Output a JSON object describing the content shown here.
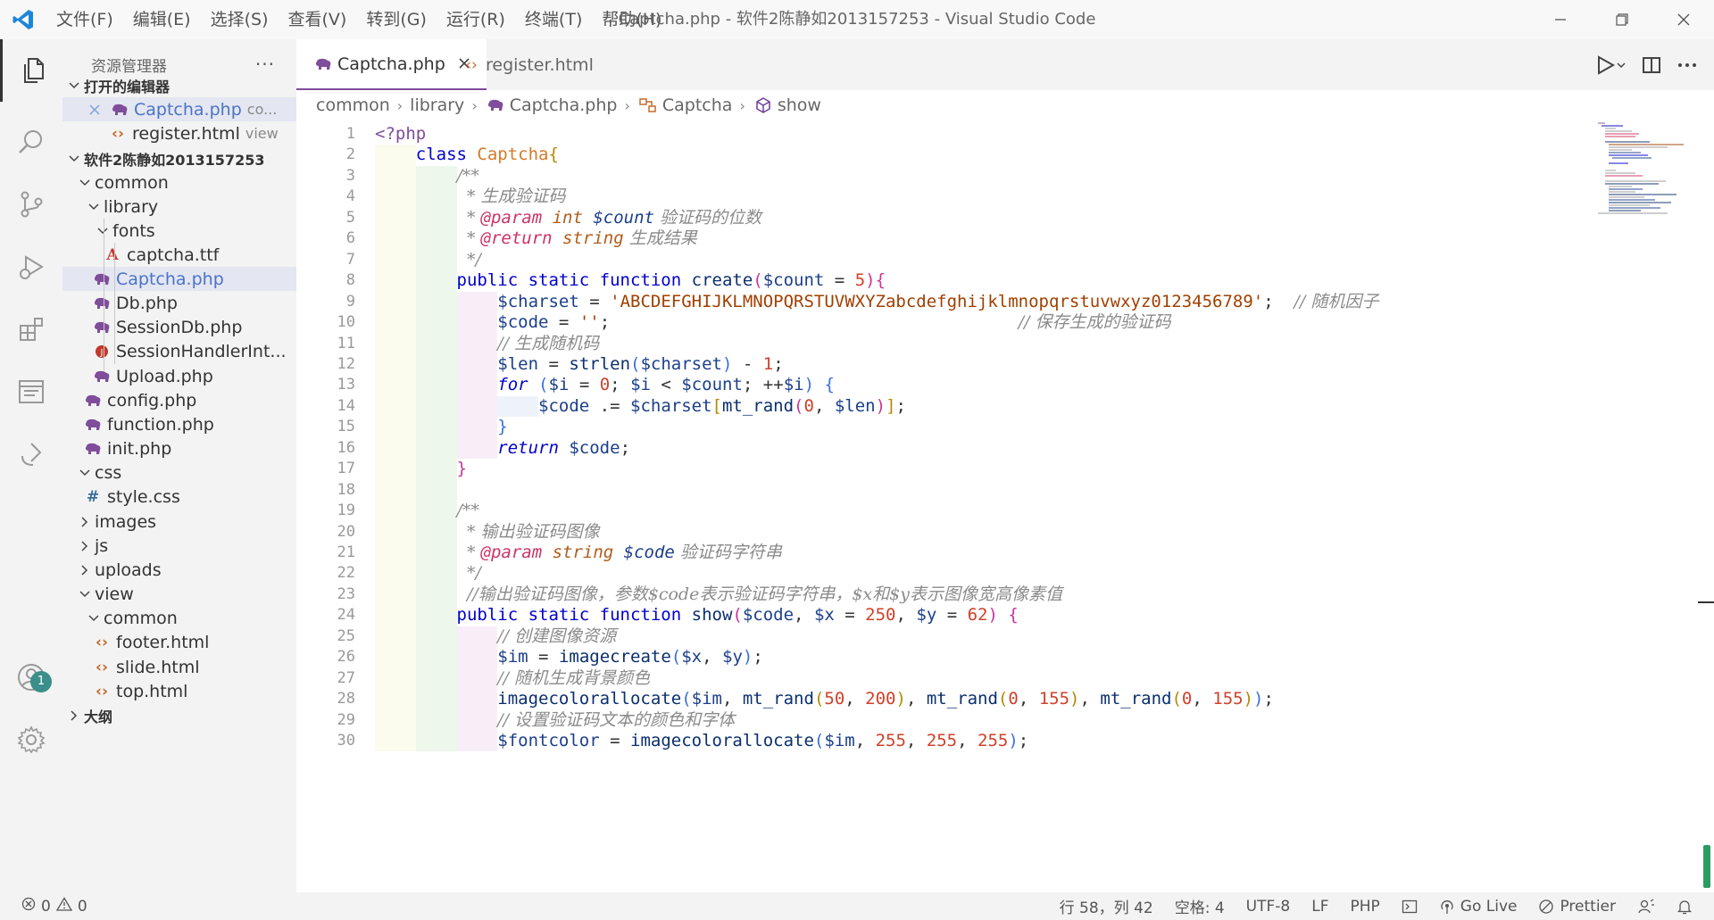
{
  "window": {
    "title": "Captcha.php - 软件2陈静如2013157253 - Visual Studio Code",
    "menu": [
      "文件(F)",
      "编辑(E)",
      "选择(S)",
      "查看(V)",
      "转到(G)",
      "运行(R)",
      "终端(T)",
      "帮助(H)"
    ]
  },
  "sidebar": {
    "title": "资源管理器",
    "more": "···",
    "open_editors_label": "打开的编辑器",
    "open_editors": [
      {
        "name": "Captcha.php",
        "desc": "co..."
      },
      {
        "name": "register.html",
        "desc": "view"
      }
    ],
    "project_label": "软件2陈静如2013157253",
    "outline_label": "大纲",
    "tree": [
      {
        "name": "common"
      },
      {
        "name": "library"
      },
      {
        "name": "fonts"
      },
      {
        "name": "captcha.ttf"
      },
      {
        "name": "Captcha.php"
      },
      {
        "name": "Db.php"
      },
      {
        "name": "SessionDb.php"
      },
      {
        "name": "SessionHandlerInt..."
      },
      {
        "name": "Upload.php"
      },
      {
        "name": "config.php"
      },
      {
        "name": "function.php"
      },
      {
        "name": "init.php"
      },
      {
        "name": "css"
      },
      {
        "name": "style.css"
      },
      {
        "name": "images"
      },
      {
        "name": "js"
      },
      {
        "name": "uploads"
      },
      {
        "name": "view"
      },
      {
        "name": "common"
      },
      {
        "name": "footer.html"
      },
      {
        "name": "slide.html"
      },
      {
        "name": "top.html"
      }
    ]
  },
  "activity": {
    "accounts_badge": "1"
  },
  "tabs": [
    {
      "label": "Captcha.php",
      "active": true
    },
    {
      "label": "register.html",
      "active": false
    }
  ],
  "breadcrumb": [
    "common",
    "library",
    "Captcha.php",
    "Captcha",
    "show"
  ],
  "line_numbers": [
    "1",
    "2",
    "3",
    "4",
    "5",
    "6",
    "7",
    "8",
    "9",
    "10",
    "11",
    "12",
    "13",
    "14",
    "15",
    "16",
    "17",
    "18",
    "19",
    "20",
    "21",
    "22",
    "23",
    "24",
    "25",
    "26",
    "27",
    "28",
    "29",
    "30"
  ],
  "code": [
    [
      [
        "<?php",
        "tag"
      ]
    ],
    [
      [
        "    ",
        ""
      ],
      [
        "class ",
        "kw"
      ],
      [
        "Captcha",
        "cls"
      ],
      [
        "{",
        "br"
      ]
    ],
    [
      [
        "        ",
        ""
      ],
      [
        "/**",
        "cmt"
      ]
    ],
    [
      [
        "         ",
        ""
      ],
      [
        "* 生成验证码",
        "cmt"
      ]
    ],
    [
      [
        "         ",
        ""
      ],
      [
        "* ",
        "cmt"
      ],
      [
        "@param",
        "doc"
      ],
      [
        " int ",
        "type"
      ],
      [
        "$count",
        "var-i"
      ],
      [
        " 验证码的位数",
        "cmt"
      ]
    ],
    [
      [
        "         ",
        ""
      ],
      [
        "* ",
        "cmt"
      ],
      [
        "@return",
        "doc"
      ],
      [
        " string",
        "type"
      ],
      [
        " 生成结果",
        "cmt"
      ]
    ],
    [
      [
        "         ",
        ""
      ],
      [
        "*/",
        "cmt"
      ]
    ],
    [
      [
        "        ",
        ""
      ],
      [
        "public static function ",
        "kw"
      ],
      [
        "create",
        "fn"
      ],
      [
        "(",
        "br2"
      ],
      [
        "$count",
        "var"
      ],
      [
        " = ",
        "pun"
      ],
      [
        "5",
        "num"
      ],
      [
        ")",
        "br2"
      ],
      [
        "{",
        "br2"
      ]
    ],
    [
      [
        "            ",
        ""
      ],
      [
        "$charset",
        "var"
      ],
      [
        " = ",
        "pun"
      ],
      [
        "'ABCDEFGHIJKLMNOPQRSTUVWXYZabcdefghijklmnopqrstuvwxyz0123456789'",
        "str"
      ],
      [
        ";  ",
        "pun"
      ],
      [
        "// 随机因子",
        "cmt"
      ]
    ],
    [
      [
        "            ",
        ""
      ],
      [
        "$code",
        "var"
      ],
      [
        " = ",
        "pun"
      ],
      [
        "''",
        "str"
      ],
      [
        ";",
        "pun"
      ],
      [
        "                                        ",
        ""
      ],
      [
        "// 保存生成的验证码",
        "cmt"
      ]
    ],
    [
      [
        "            ",
        ""
      ],
      [
        "// 生成随机码",
        "cmt"
      ]
    ],
    [
      [
        "            ",
        ""
      ],
      [
        "$len",
        "var"
      ],
      [
        " = ",
        "pun"
      ],
      [
        "strlen",
        "fn"
      ],
      [
        "(",
        "br3"
      ],
      [
        "$charset",
        "var"
      ],
      [
        ")",
        "br3"
      ],
      [
        " - ",
        "pun"
      ],
      [
        "1",
        "num"
      ],
      [
        ";",
        "pun"
      ]
    ],
    [
      [
        "            ",
        ""
      ],
      [
        "for",
        "kw-i"
      ],
      [
        " (",
        "br3"
      ],
      [
        "$i",
        "var"
      ],
      [
        " = ",
        "pun"
      ],
      [
        "0",
        "num"
      ],
      [
        "; ",
        "pun"
      ],
      [
        "$i",
        "var"
      ],
      [
        " < ",
        "pun"
      ],
      [
        "$count",
        "var"
      ],
      [
        "; ++",
        "pun"
      ],
      [
        "$i",
        "var"
      ],
      [
        ") {",
        "br3"
      ]
    ],
    [
      [
        "                ",
        ""
      ],
      [
        "$code",
        "var"
      ],
      [
        " .= ",
        "pun"
      ],
      [
        "$charset",
        "var"
      ],
      [
        "[",
        "br"
      ],
      [
        "mt_rand",
        "fn"
      ],
      [
        "(",
        "br2"
      ],
      [
        "0",
        "num"
      ],
      [
        ", ",
        "pun"
      ],
      [
        "$len",
        "var"
      ],
      [
        ")",
        "br2"
      ],
      [
        "]",
        "br"
      ],
      [
        ";",
        "pun"
      ]
    ],
    [
      [
        "            ",
        ""
      ],
      [
        "}",
        "br3"
      ]
    ],
    [
      [
        "            ",
        ""
      ],
      [
        "return",
        "kw-i"
      ],
      [
        " $code",
        "var"
      ],
      [
        ";",
        "pun"
      ]
    ],
    [
      [
        "        ",
        ""
      ],
      [
        "}",
        "br2"
      ]
    ],
    [
      [
        "",
        ""
      ]
    ],
    [
      [
        "        ",
        ""
      ],
      [
        "/**",
        "cmt"
      ]
    ],
    [
      [
        "         ",
        ""
      ],
      [
        "* 输出验证码图像",
        "cmt"
      ]
    ],
    [
      [
        "         ",
        ""
      ],
      [
        "* ",
        "cmt"
      ],
      [
        "@param",
        "doc"
      ],
      [
        " string",
        "type"
      ],
      [
        " $code",
        "var-i"
      ],
      [
        " 验证码字符串",
        "cmt"
      ]
    ],
    [
      [
        "         ",
        ""
      ],
      [
        "*/",
        "cmt"
      ]
    ],
    [
      [
        "         ",
        ""
      ],
      [
        "//输出验证码图像，参数$code表示验证码字符串，$x和$y表示图像宽高像素值",
        "cmt"
      ]
    ],
    [
      [
        "        ",
        ""
      ],
      [
        "public static function ",
        "kw"
      ],
      [
        "show",
        "fn"
      ],
      [
        "(",
        "br2"
      ],
      [
        "$code",
        "var"
      ],
      [
        ", ",
        "pun"
      ],
      [
        "$x",
        "var"
      ],
      [
        " = ",
        "pun"
      ],
      [
        "250",
        "num"
      ],
      [
        ", ",
        "pun"
      ],
      [
        "$y",
        "var"
      ],
      [
        " = ",
        "pun"
      ],
      [
        "62",
        "num"
      ],
      [
        ") ",
        "br2"
      ],
      [
        "{",
        "br2"
      ]
    ],
    [
      [
        "            ",
        ""
      ],
      [
        "// 创建图像资源",
        "cmt"
      ]
    ],
    [
      [
        "            ",
        ""
      ],
      [
        "$im",
        "var"
      ],
      [
        " = ",
        "pun"
      ],
      [
        "imagecreate",
        "fn"
      ],
      [
        "(",
        "br3"
      ],
      [
        "$x",
        "var"
      ],
      [
        ", ",
        "pun"
      ],
      [
        "$y",
        "var"
      ],
      [
        ")",
        "br3"
      ],
      [
        ";",
        "pun"
      ]
    ],
    [
      [
        "            ",
        ""
      ],
      [
        "// 随机生成背景颜色",
        "cmt"
      ]
    ],
    [
      [
        "            ",
        ""
      ],
      [
        "imagecolorallocate",
        "fn"
      ],
      [
        "(",
        "br3"
      ],
      [
        "$im",
        "var"
      ],
      [
        ", ",
        "pun"
      ],
      [
        "mt_rand",
        "fn"
      ],
      [
        "(",
        "br"
      ],
      [
        "50",
        "num"
      ],
      [
        ", ",
        "pun"
      ],
      [
        "200",
        "num"
      ],
      [
        ")",
        "br"
      ],
      [
        ", ",
        "pun"
      ],
      [
        "mt_rand",
        "fn"
      ],
      [
        "(",
        "br"
      ],
      [
        "0",
        "num"
      ],
      [
        ", ",
        "pun"
      ],
      [
        "155",
        "num"
      ],
      [
        ")",
        "br"
      ],
      [
        ", ",
        "pun"
      ],
      [
        "mt_rand",
        "fn"
      ],
      [
        "(",
        "br"
      ],
      [
        "0",
        "num"
      ],
      [
        ", ",
        "pun"
      ],
      [
        "155",
        "num"
      ],
      [
        ")",
        "br"
      ],
      [
        ")",
        "br3"
      ],
      [
        ";",
        "pun"
      ]
    ],
    [
      [
        "            ",
        ""
      ],
      [
        "// 设置验证码文本的颜色和字体",
        "cmt"
      ]
    ],
    [
      [
        "            ",
        ""
      ],
      [
        "$fontcolor",
        "var"
      ],
      [
        " = ",
        "pun"
      ],
      [
        "imagecolorallocate",
        "fn"
      ],
      [
        "(",
        "br3"
      ],
      [
        "$im",
        "var"
      ],
      [
        ", ",
        "pun"
      ],
      [
        "255",
        "num"
      ],
      [
        ", ",
        "pun"
      ],
      [
        "255",
        "num"
      ],
      [
        ", ",
        "pun"
      ],
      [
        "255",
        "num"
      ],
      [
        ")",
        "br3"
      ],
      [
        ";",
        "pun"
      ]
    ]
  ],
  "status": {
    "errors": "0",
    "warnings": "0",
    "position": "行 58，列 42",
    "spaces": "空格: 4",
    "encoding": "UTF-8",
    "eol": "LF",
    "language": "PHP",
    "golive": "Go Live",
    "prettier": "Prettier"
  },
  "colors": {
    "php_icon": "#7f4d9a",
    "html_icon": "#c26b2f",
    "selection_bg": "#e4e6f1",
    "badge": "#3a8f8a"
  }
}
